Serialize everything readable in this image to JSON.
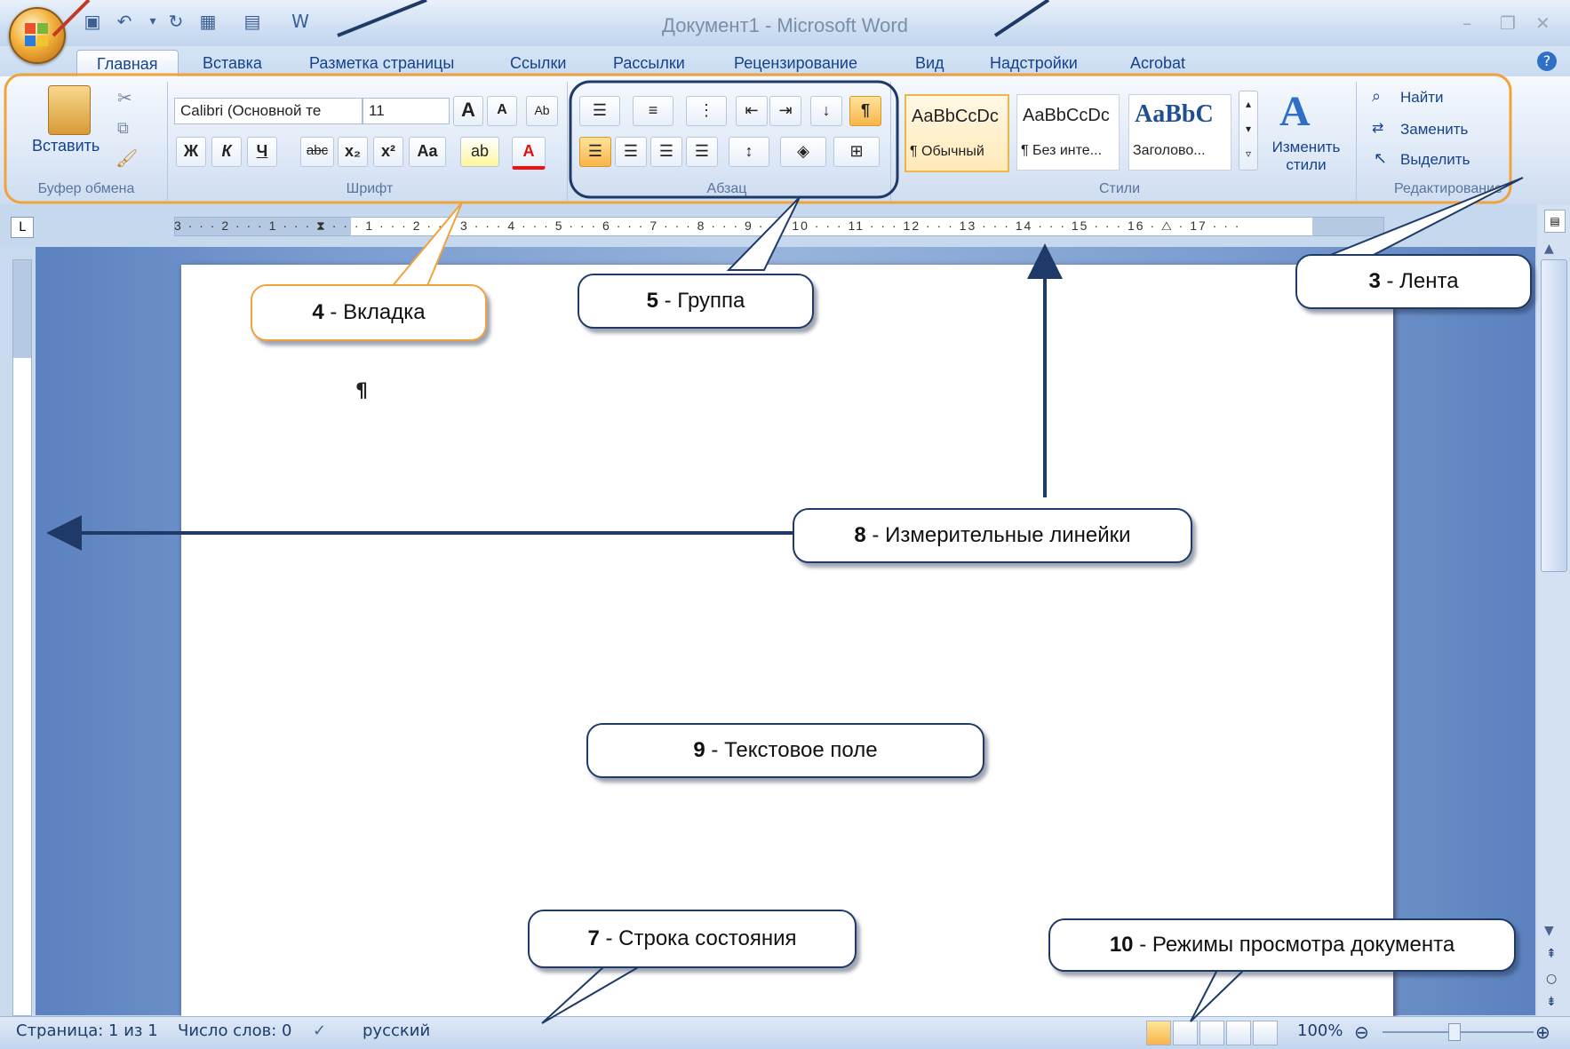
{
  "window": {
    "title": "Документ1 - Microsoft Word"
  },
  "tabs": [
    "Главная",
    "Вставка",
    "Разметка страницы",
    "Ссылки",
    "Рассылки",
    "Рецензирование",
    "Вид",
    "Надстройки",
    "Acrobat"
  ],
  "clipboard": {
    "paste_label": "Вставить",
    "group_label": "Буфер обмена"
  },
  "font": {
    "name": "Calibri (Основной те",
    "size": "11",
    "group_label": "Шрифт",
    "bold": "Ж",
    "italic": "К",
    "underline": "Ч",
    "strike": "abc",
    "subscript": "x₂",
    "superscript": "x²",
    "case": "Aa",
    "grow": "A",
    "shrink": "A"
  },
  "paragraph": {
    "group_label": "Абзац",
    "pilcrow": "¶"
  },
  "styles": {
    "group_label": "Стили",
    "items": [
      {
        "sample": "AaBbCcDc",
        "name": "¶ Обычный"
      },
      {
        "sample": "AaBbCcDc",
        "name": "¶ Без инте..."
      },
      {
        "sample": "AaBbC",
        "name": "Заголово..."
      }
    ],
    "change_label": "Изменить стили"
  },
  "editing": {
    "group_label": "Редактирование",
    "find": "Найти",
    "replace": "Заменить",
    "select": "Выделить"
  },
  "ruler": {
    "numbers": "3 · · · 2 · · · 1 · · · ⧗ · · · 1 · · · 2 · · · 3 · · · 4 · · · 5 · · · 6 · · · 7 · · · 8 · · · 9 · · · 10 · · · 11 · · · 12 · · · 13 · · · 14 · · · 15 · · · 16 · △ · 17 · · ·"
  },
  "document": {
    "pilcrow": "¶"
  },
  "status": {
    "page": "Страница: 1 из 1",
    "words": "Число слов: 0",
    "language": "русский",
    "zoom": "100%"
  },
  "callouts": {
    "ribbon": {
      "num": "3",
      "text": " - Лента"
    },
    "tab": {
      "num": "4",
      "text": " - Вкладка"
    },
    "group": {
      "num": "5",
      "text": " - Группа"
    },
    "statusbar": {
      "num": "7",
      "text": " - Строка состояния"
    },
    "rulers": {
      "num": "8",
      "text": " - Измерительные линейки"
    },
    "textfield": {
      "num": "9",
      "text": " - Текстовое поле"
    },
    "views": {
      "num": "10",
      "text": " - Режимы просмотра документа"
    }
  },
  "colors": {
    "accent": "#15428b",
    "orange_highlight": "#f0a23c",
    "callout_border": "#1f3a66"
  }
}
